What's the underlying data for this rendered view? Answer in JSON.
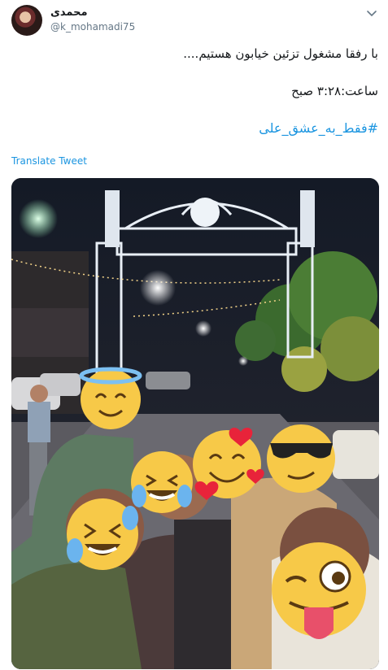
{
  "user": {
    "display_name": "محمدی",
    "handle": "@k_mohamadi75"
  },
  "tweet": {
    "line1": "با رفقا مشغول تزئین خیابون هستیم....",
    "line2": "ساعت:۳:۲۸ صبح",
    "hashtag": "#فقط_به_عشق_علی"
  },
  "translate_label": "Translate Tweet",
  "icons": {
    "menu": "chevron-down-icon",
    "avatar": "user-avatar-image"
  },
  "photo": {
    "description_icon": "photo-image",
    "emoji_overlays": [
      "halo-smile-emoji",
      "laughing-tears-emoji",
      "heart-eyes-hearts-emoji",
      "sunglasses-emoji",
      "laughing-tears-emoji",
      "wink-tongue-emoji"
    ]
  },
  "colors": {
    "link": "#1b95e0",
    "secondary_text": "#657786",
    "emoji_yellow": "#f7c948"
  }
}
